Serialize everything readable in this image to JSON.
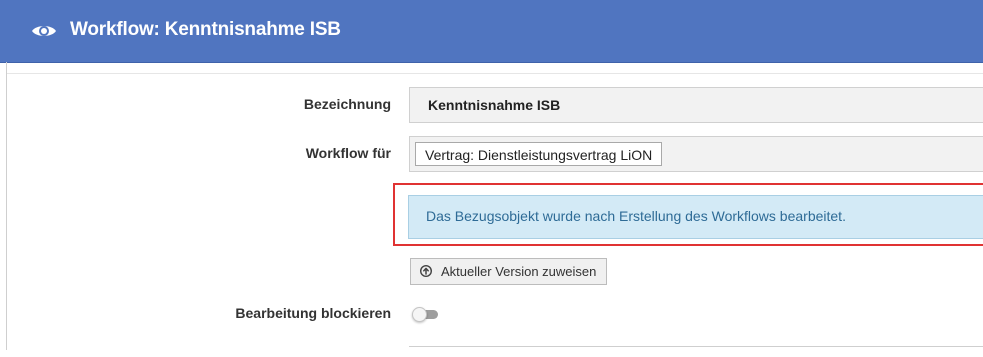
{
  "header": {
    "title": "Workflow: Kenntnisnahme ISB",
    "icon": "eye-icon",
    "color": "#5075c0"
  },
  "form": {
    "name_label": "Bezeichnung",
    "name_value": "Kenntnisnahme ISB",
    "for_label": "Workflow für",
    "for_value": "Vertrag: Dienstleistungsvertrag LiON",
    "alert_text": "Das Bezugsobjekt wurde nach Erstellung des Workflows bearbeitet.",
    "assign_button_label": "Aktueller Version zuweisen",
    "block_label": "Bearbeitung blockieren",
    "block_enabled": false
  },
  "colors": {
    "alert_bg": "#d3eaf6",
    "alert_text": "#2e6b96",
    "highlight": "#e03333"
  }
}
